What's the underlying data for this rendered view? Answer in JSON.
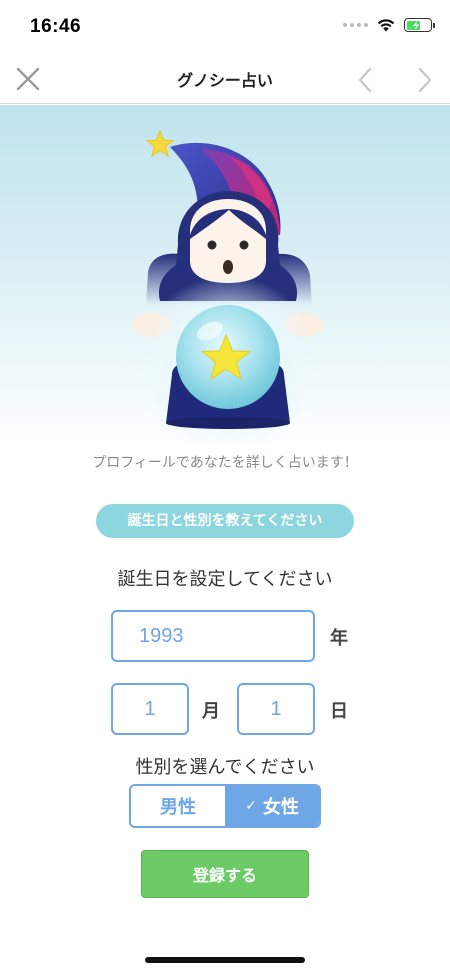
{
  "status_bar": {
    "time": "16:46"
  },
  "nav": {
    "title": "グノシー占い",
    "icons": [
      "close-icon",
      "chevron-left-icon",
      "chevron-right-icon"
    ]
  },
  "hero": {
    "illustration": "fortune-teller-with-crystal-ball"
  },
  "intro_text": "プロフィールであなたを詳しく占います！",
  "badge_text": "誕生日と性別を教えてください",
  "birthday": {
    "label": "誕生日を設定してください",
    "year_value": "1993",
    "year_unit": "年",
    "month_value": "1",
    "month_unit": "月",
    "day_value": "1",
    "day_unit": "日"
  },
  "gender": {
    "label": "性別を選んでください",
    "male_label": "男性",
    "female_label": "女性",
    "selected": "女性"
  },
  "register_label": "登録する",
  "colors": {
    "accent_blue": "#6ea6e6",
    "badge_teal": "#8ed6df",
    "register_green": "#6ccb66",
    "hero_sky": "#bfe3ec"
  }
}
